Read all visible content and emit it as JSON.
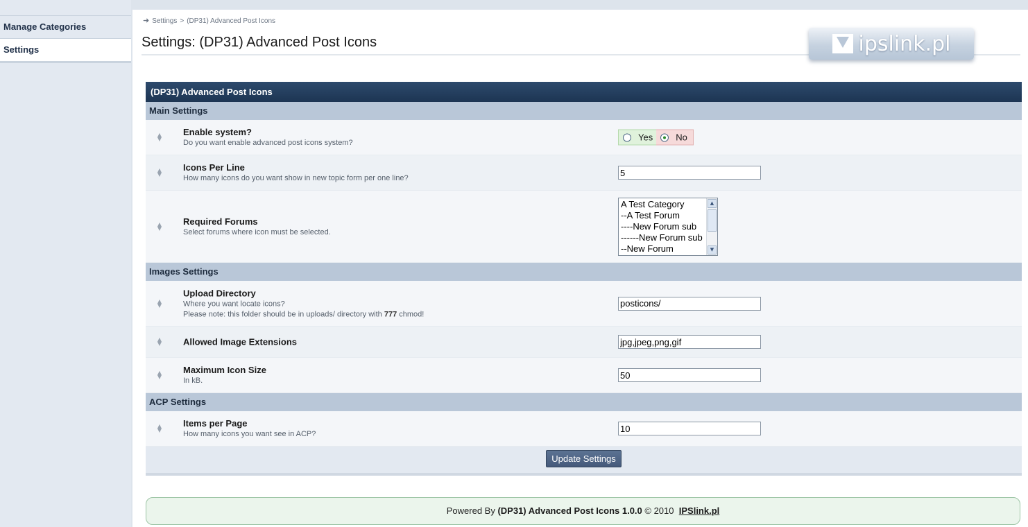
{
  "sidebar": {
    "items": [
      {
        "label": "Manage Categories"
      },
      {
        "label": "Settings"
      }
    ]
  },
  "breadcrumb": {
    "items": [
      "Settings",
      "(DP31) Advanced Post Icons"
    ],
    "separator": ">"
  },
  "page_title": "Settings: (DP31) Advanced Post Icons",
  "logo": {
    "text": "ipslink.pl"
  },
  "panel": {
    "title": "(DP31) Advanced Post Icons",
    "sections": {
      "main": "Main Settings",
      "images": "Images Settings",
      "acp": "ACP Settings"
    }
  },
  "settings": {
    "enable": {
      "title": "Enable system?",
      "desc": "Do you want enable advanced post icons system?",
      "yes_label": "Yes",
      "no_label": "No",
      "selected": "No"
    },
    "icons_per_line": {
      "title": "Icons Per Line",
      "desc": "How many icons do you want show in new topic form per one line?",
      "value": "5"
    },
    "required_forums": {
      "title": "Required Forums",
      "desc": "Select forums where icon must be selected.",
      "options": [
        "A Test Category",
        "--A Test Forum",
        "----New Forum sub",
        "------New Forum sub",
        "--New Forum"
      ]
    },
    "upload_dir": {
      "title": "Upload Directory",
      "desc1": "Where you want locate icons?",
      "desc2_pre": "Please note: this folder should be in uploads/ directory with",
      "desc2_bold": "777",
      "desc2_post": "chmod!",
      "value": "posticons/"
    },
    "extensions": {
      "title": "Allowed Image Extensions",
      "value": "jpg,jpeg,png,gif"
    },
    "max_size": {
      "title": "Maximum Icon Size",
      "desc": "In kB.",
      "value": "50"
    },
    "items_per_page": {
      "title": "Items per Page",
      "desc": "How many icons you want see in ACP?",
      "value": "10"
    }
  },
  "update_button": "Update Settings",
  "footer": {
    "pre": "Powered By",
    "product": "(DP31) Advanced Post Icons 1.0.0",
    "copyright": "© 2010",
    "link": "IPSlink.pl"
  },
  "colors": {
    "panel_header": "#1d3553",
    "section_header": "#b9c7d8",
    "sidebar_bg": "#e3e9f1",
    "yes_bg": "#e0f2dc",
    "no_bg": "#f6dada",
    "footer_bg": "#ebf5ec"
  }
}
